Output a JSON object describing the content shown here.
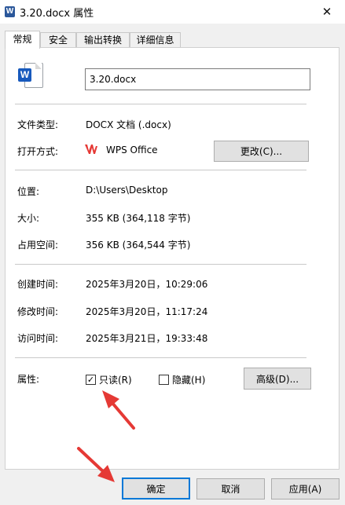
{
  "window": {
    "title": "3.20.docx 属性",
    "close_glyph": "✕",
    "title_icon_letter": "W"
  },
  "tabs": [
    {
      "label": "常规",
      "active": true
    },
    {
      "label": "安全",
      "active": false
    },
    {
      "label": "输出转换",
      "active": false
    },
    {
      "label": "详细信息",
      "active": false
    }
  ],
  "file": {
    "name": "3.20.docx",
    "icon": "word-doc-icon",
    "icon_letter": "W"
  },
  "type_row": {
    "label": "文件类型:",
    "value": "DOCX 文档 (.docx)"
  },
  "opens_row": {
    "label": "打开方式:",
    "app": "WPS Office",
    "app_icon": "wps-icon",
    "change_button": "更改(C)..."
  },
  "location_row": {
    "label": "位置:",
    "value": "D:\\Users\\Desktop"
  },
  "size_row": {
    "label": "大小:",
    "value": "355 KB (364,118 字节)"
  },
  "disk_row": {
    "label": "占用空间:",
    "value": "356 KB (364,544 字节)"
  },
  "created_row": {
    "label": "创建时间:",
    "value": "2025年3月20日，10:29:06"
  },
  "modified_row": {
    "label": "修改时间:",
    "value": "2025年3月20日，11:17:24"
  },
  "accessed_row": {
    "label": "访问时间:",
    "value": "2025年3月21日，19:33:48"
  },
  "attributes": {
    "label": "属性:",
    "readonly": {
      "label": "只读(R)",
      "checked": true,
      "mark": "✓"
    },
    "hidden": {
      "label": "隐藏(H)",
      "checked": false
    },
    "advanced_button": "高级(D)..."
  },
  "footer": {
    "ok": "确定",
    "cancel": "取消",
    "apply": "应用(A)"
  },
  "annotation_color": "#e53935"
}
